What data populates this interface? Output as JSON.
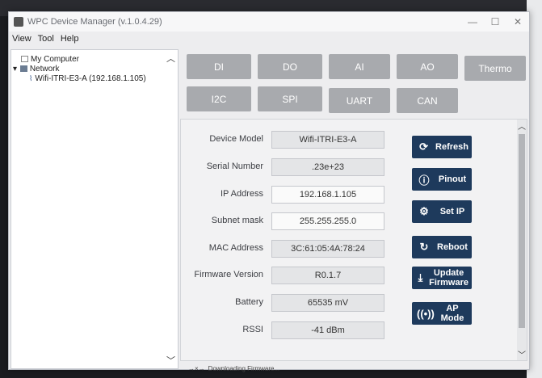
{
  "window": {
    "title": "WPC Device Manager (v.1.0.4.29)",
    "min": "—",
    "max": "☐",
    "close": "✕"
  },
  "menu": [
    "View",
    "Tool",
    "Help"
  ],
  "tree": {
    "root": "My Computer",
    "network": "Network",
    "device": "Wifi-ITRI-E3-A (192.168.1.105)"
  },
  "tabs": [
    "DI",
    "DO",
    "AI",
    "AO",
    "Thermo",
    "I2C",
    "SPI",
    "UART",
    "CAN"
  ],
  "fields": [
    {
      "label": "Device Model",
      "value": "Wifi-ITRI-E3-A"
    },
    {
      "label": "Serial Number",
      "value": ".23e+23"
    },
    {
      "label": "IP Address",
      "value": "192.168.1.105"
    },
    {
      "label": "Subnet mask",
      "value": "255.255.255.0"
    },
    {
      "label": "MAC Address",
      "value": "3C:61:05:4A:78:24"
    },
    {
      "label": "Firmware Version",
      "value": "R0.1.7"
    },
    {
      "label": "Battery",
      "value": "65535 mV"
    },
    {
      "label": "RSSI",
      "value": "-41 dBm"
    }
  ],
  "actions": [
    {
      "label": "Refresh",
      "icon": "refresh-icon"
    },
    {
      "label": "Pinout",
      "icon": "info-icon"
    },
    {
      "label": "Set IP",
      "icon": "gear-icon"
    },
    {
      "label": "Reboot",
      "icon": "reboot-icon"
    },
    {
      "label": "Update Firmware",
      "icon": "download-icon"
    },
    {
      "label": "AP Mode",
      "icon": "wireless-icon"
    }
  ],
  "status": "Downloading Firmware..."
}
